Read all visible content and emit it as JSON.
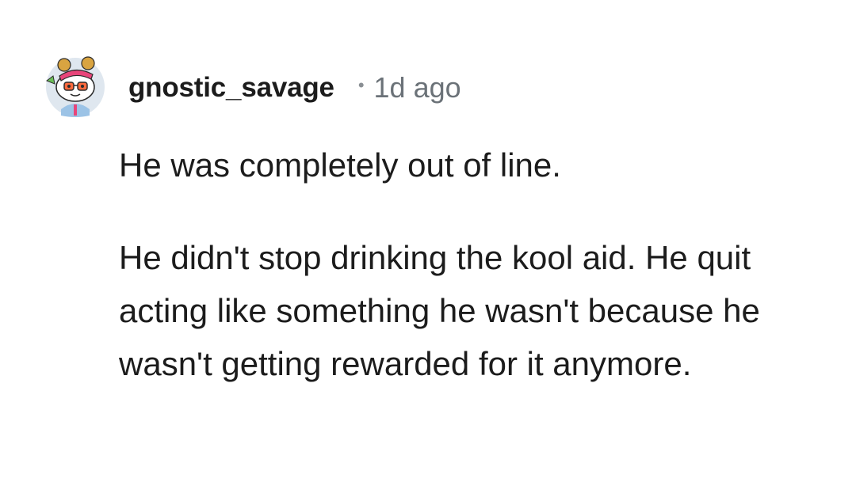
{
  "comment": {
    "author": "gnostic_savage",
    "separator": "•",
    "timestamp": "1d ago",
    "avatar_icon": "snoo-avatar-icon",
    "paragraphs": [
      "He was completely out of line.",
      "He didn't stop drinking the kool aid. He quit acting like something he wasn't because he wasn't getting rewarded for it anymore."
    ]
  },
  "colors": {
    "text": "#1c1c1c",
    "meta": "#6b7278",
    "avatar_bg": "#dfe7ef",
    "accent": "#e8457a"
  }
}
